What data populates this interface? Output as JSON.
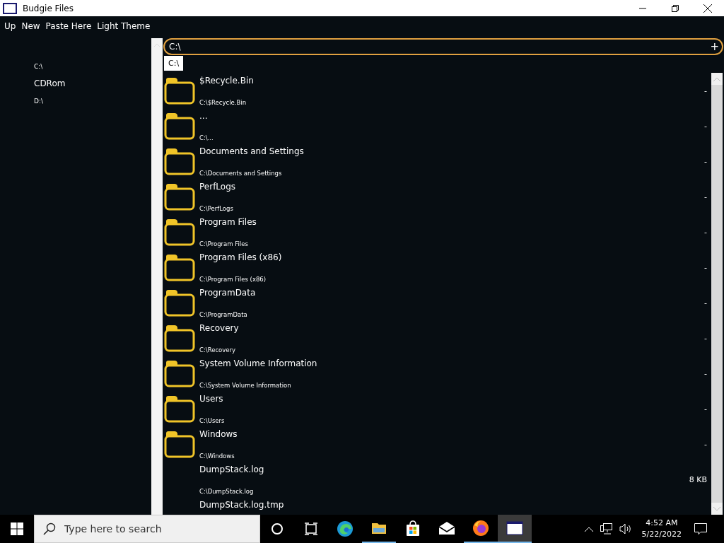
{
  "window": {
    "title": "Budgie Files"
  },
  "menu": [
    "Up",
    "New",
    "Paste Here",
    "Light Theme"
  ],
  "sidebar": {
    "items": [
      {
        "label": "C:\\",
        "kind": "drive"
      },
      {
        "label": "CDRom",
        "kind": "group"
      },
      {
        "label": "D:\\",
        "kind": "drive"
      }
    ]
  },
  "path_field": {
    "value": "C:\\",
    "add_button": "+"
  },
  "suggestions": [
    "C:\\"
  ],
  "files": [
    {
      "kind": "folder",
      "name": "$Recycle.Bin",
      "path": "C:\\$Recycle.Bin",
      "size": "-"
    },
    {
      "kind": "folder",
      "name": "...",
      "path": "C:\\...",
      "size": "-"
    },
    {
      "kind": "folder",
      "name": "Documents and Settings",
      "path": "C:\\Documents and Settings",
      "size": "-"
    },
    {
      "kind": "folder",
      "name": "PerfLogs",
      "path": "C:\\PerfLogs",
      "size": "-"
    },
    {
      "kind": "folder",
      "name": "Program Files",
      "path": "C:\\Program Files",
      "size": "-"
    },
    {
      "kind": "folder",
      "name": "Program Files (x86)",
      "path": "C:\\Program Files (x86)",
      "size": "-"
    },
    {
      "kind": "folder",
      "name": "ProgramData",
      "path": "C:\\ProgramData",
      "size": "-"
    },
    {
      "kind": "folder",
      "name": "Recovery",
      "path": "C:\\Recovery",
      "size": "-"
    },
    {
      "kind": "folder",
      "name": "System Volume Information",
      "path": "C:\\System Volume Information",
      "size": "-"
    },
    {
      "kind": "folder",
      "name": "Users",
      "path": "C:\\Users",
      "size": "-"
    },
    {
      "kind": "folder",
      "name": "Windows",
      "path": "C:\\Windows",
      "size": "-"
    },
    {
      "kind": "file",
      "name": "DumpStack.log",
      "path": "C:\\DumpStack.log",
      "size": "8 KB"
    },
    {
      "kind": "file",
      "name": "DumpStack.log.tmp"
    }
  ],
  "taskbar": {
    "search_placeholder": "Type here to search",
    "apps": [
      {
        "kind": "cortana",
        "running": false,
        "selected": false
      },
      {
        "kind": "taskview",
        "running": false,
        "selected": false
      },
      {
        "kind": "edge",
        "running": false,
        "selected": false
      },
      {
        "kind": "explorer",
        "running": true,
        "selected": false
      },
      {
        "kind": "store",
        "running": false,
        "selected": false
      },
      {
        "kind": "mail",
        "running": false,
        "selected": false
      },
      {
        "kind": "firefox",
        "running": true,
        "selected": false
      },
      {
        "kind": "window",
        "running": true,
        "selected": true
      }
    ],
    "time": "4:52 AM",
    "date": "5/22/2022"
  }
}
